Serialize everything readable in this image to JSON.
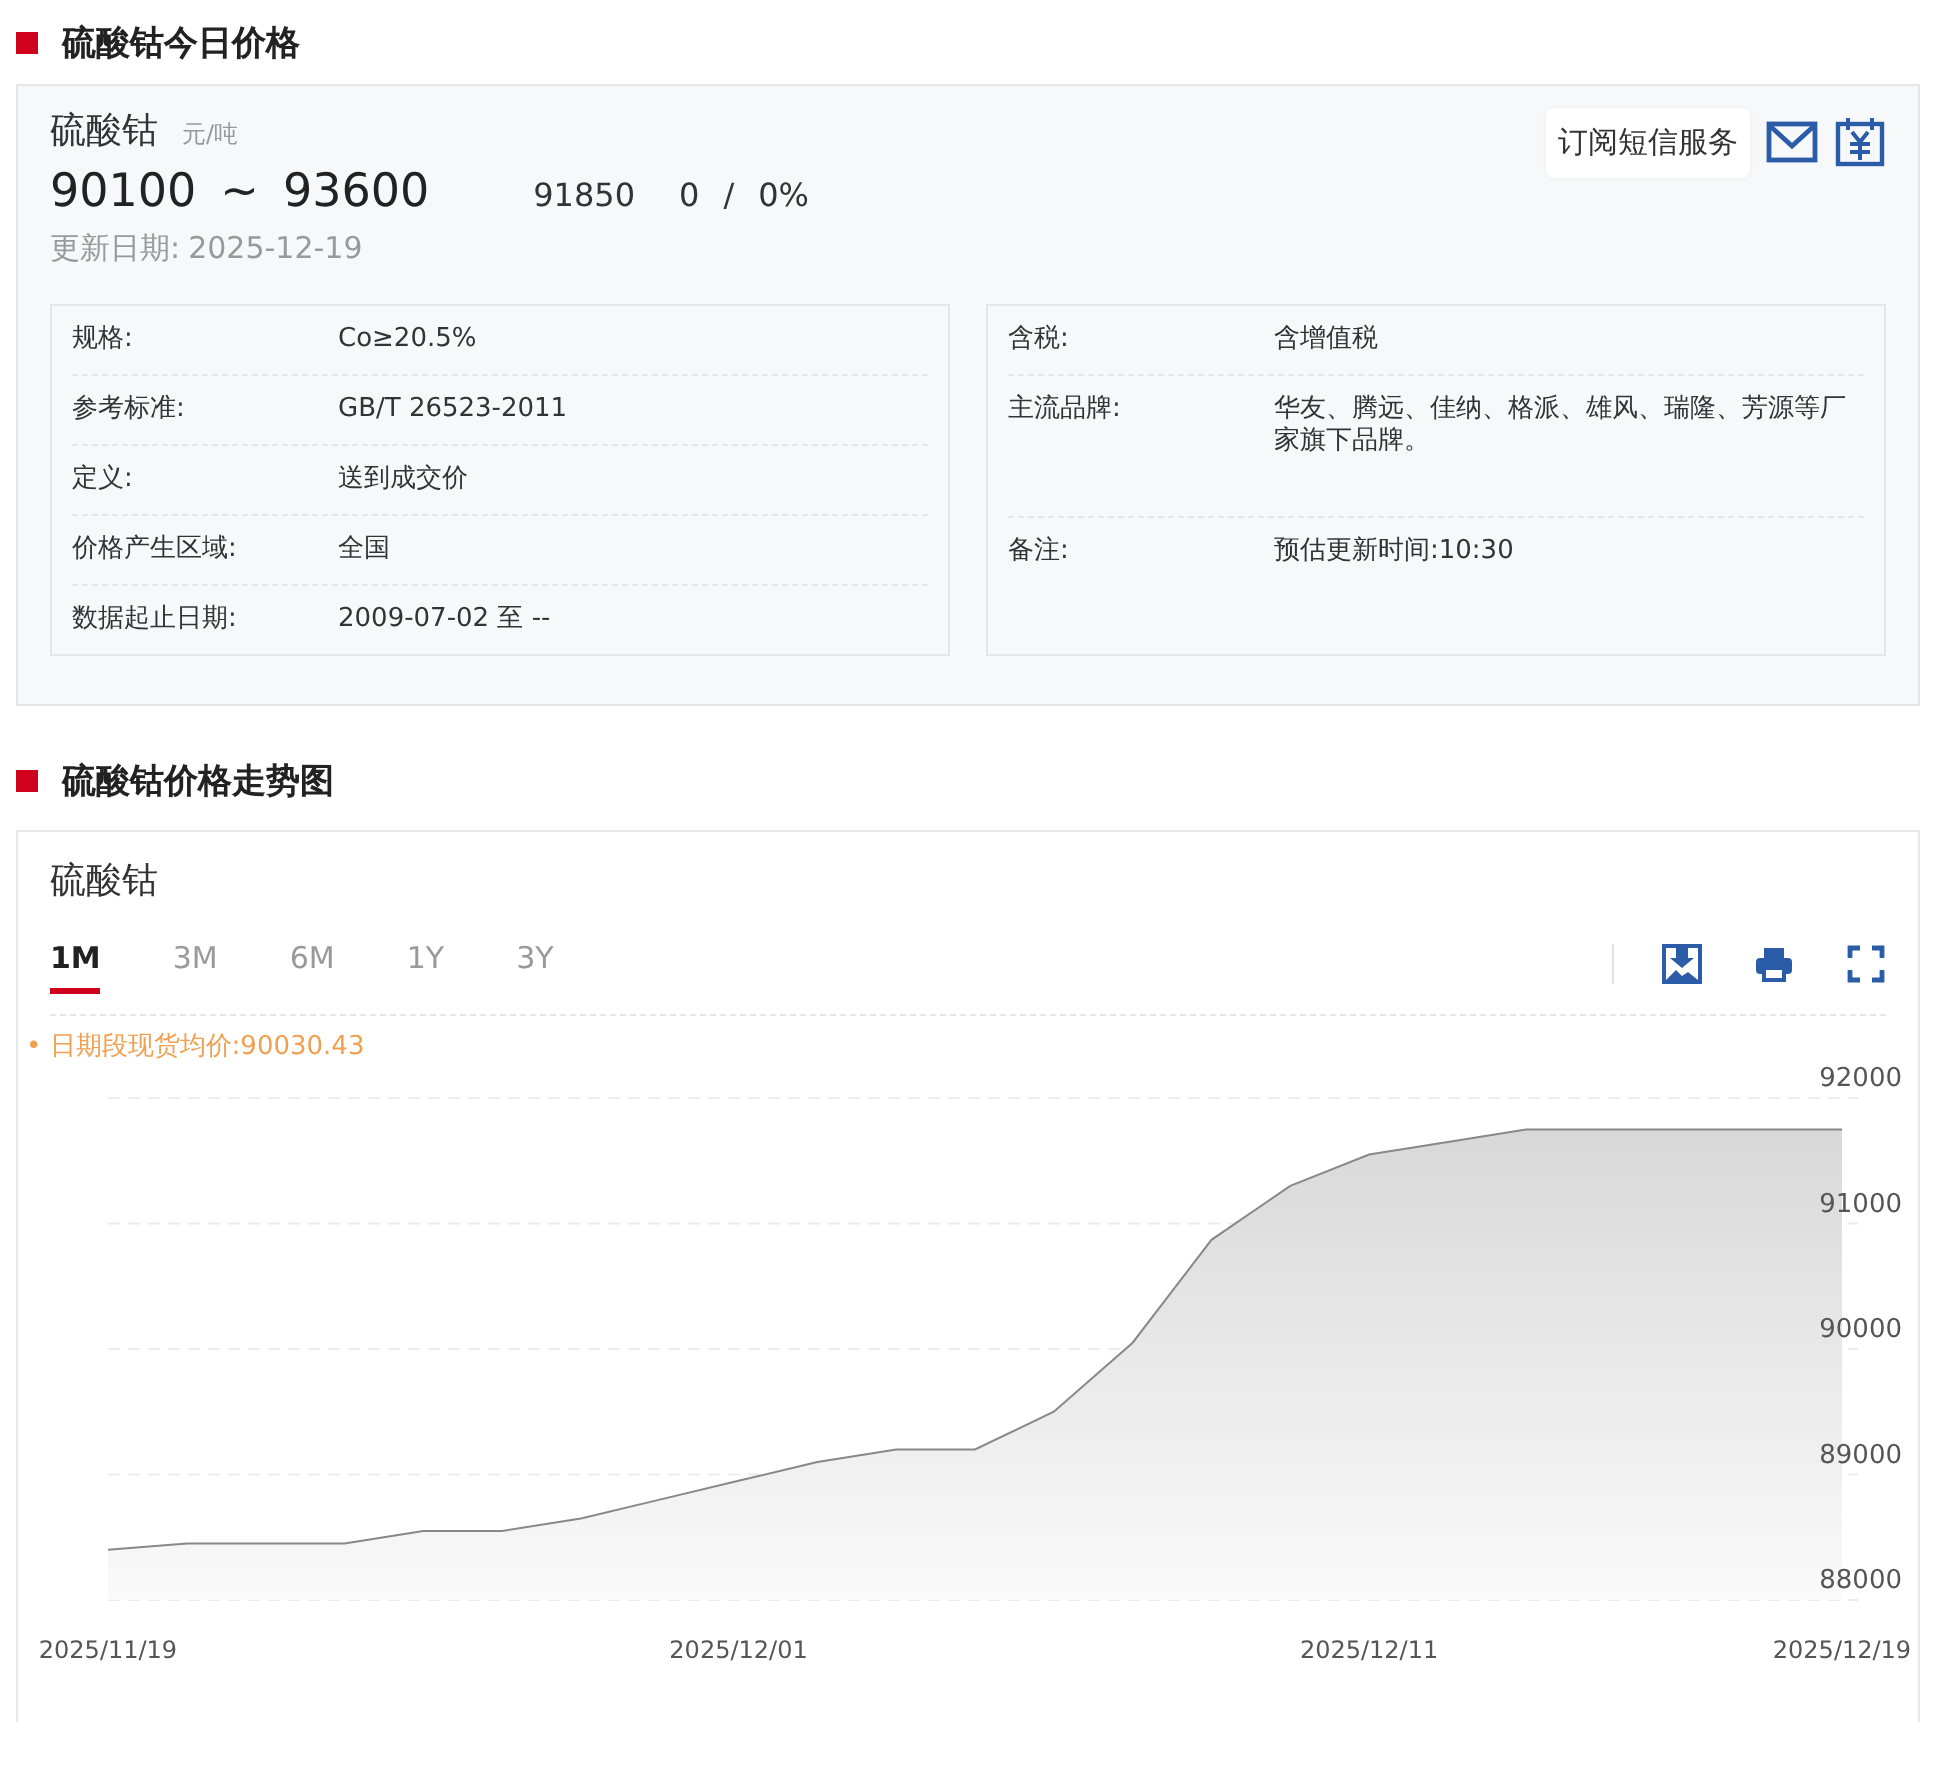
{
  "price_section": {
    "title": "硫酸钴今日价格",
    "product": "硫酸钴",
    "unit": "元/吨",
    "low": "90100",
    "tilde": "~",
    "high": "93600",
    "average": "91850",
    "change": "0",
    "slash": "/",
    "change_pct": "0%",
    "updated_label": "更新日期:",
    "updated": "2025-12-19",
    "subscribe": "订阅短信服务",
    "details_left": [
      {
        "label": "规格:",
        "value": "Co≥20.5%"
      },
      {
        "label": "参考标准:",
        "value": "GB/T 26523-2011"
      },
      {
        "label": "定义:",
        "value": "送到成交价"
      },
      {
        "label": "价格产生区域:",
        "value": "全国"
      },
      {
        "label": "数据起止日期:",
        "value": "2009-07-02 至 --"
      }
    ],
    "details_right": [
      {
        "label": "含税:",
        "value": "含增值税"
      },
      {
        "label": "主流品牌:",
        "value": "华友、腾远、佳纳、格派、雄风、瑞隆、芳源等厂家旗下品牌。"
      },
      {
        "label": "备注:",
        "value": "预估更新时间:10:30"
      }
    ]
  },
  "trend_section": {
    "title": "硫酸钴价格走势图",
    "tabs": [
      {
        "label": "1M",
        "selected": true
      },
      {
        "label": "3M",
        "selected": false
      },
      {
        "label": "6M",
        "selected": false
      },
      {
        "label": "1Y",
        "selected": false
      },
      {
        "label": "3Y",
        "selected": false
      }
    ],
    "average_note": "• 日期段现货均价:90030.43",
    "chart_data": {
      "type": "area",
      "title": "硫酸钴",
      "grid": true,
      "categories": [
        "2025/11/19",
        null,
        null,
        null,
        null,
        null,
        null,
        null,
        "2025/12/01",
        null,
        null,
        null,
        null,
        null,
        null,
        null,
        "2025/12/11",
        null,
        null,
        null,
        null,
        null,
        "2025/12/19"
      ],
      "series": [
        {
          "color": "#888888",
          "values": [
            88400,
            88450,
            88450,
            88450,
            88550,
            88550,
            88650,
            88800,
            88950,
            89100,
            89200,
            89200,
            89500,
            90050,
            90870,
            91300,
            91550,
            91650,
            91750,
            91750,
            91750,
            91750,
            91750
          ]
        }
      ],
      "ylim": [
        88000,
        92000
      ],
      "yticks": [
        88000,
        89000,
        90000,
        91000,
        92000
      ]
    }
  }
}
